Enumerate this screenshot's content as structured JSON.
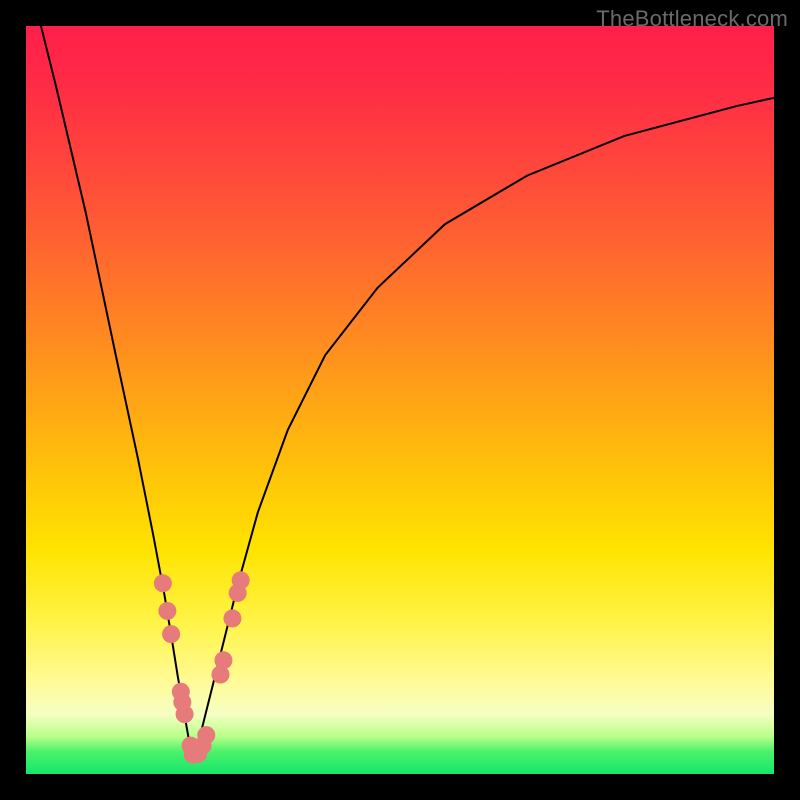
{
  "watermark": "TheBottleneck.com",
  "colors": {
    "frame": "#000000",
    "curve_stroke": "#000000",
    "marker_fill": "#e77a7a",
    "marker_stroke": "#cc5a5a"
  },
  "chart_data": {
    "type": "line",
    "title": "",
    "xlabel": "",
    "ylabel": "",
    "xlim": [
      0,
      100
    ],
    "ylim": [
      0,
      100
    ],
    "grid": false,
    "curve": {
      "description": "V-shaped bottleneck curve; two branches meeting at minimum",
      "left_branch": {
        "x": [
          0,
          4,
          8,
          12,
          15,
          17,
          18.5,
          19.5,
          20.3,
          21,
          21.7,
          22.3
        ],
        "y": [
          108,
          92,
          75,
          56,
          42,
          32,
          24,
          18,
          13,
          9,
          5,
          2.5
        ]
      },
      "right_branch": {
        "x": [
          22.3,
          23,
          24,
          25,
          26.5,
          28.5,
          31,
          35,
          40,
          47,
          56,
          67,
          80,
          95,
          100
        ],
        "y": [
          2.5,
          4,
          8,
          12,
          18,
          26,
          35,
          46,
          56,
          65,
          73.5,
          80,
          85.3,
          89.3,
          90.4
        ]
      },
      "minimum": {
        "x": 22.3,
        "y": 2.5
      }
    },
    "markers": [
      {
        "x": 18.3,
        "y": 25.5
      },
      {
        "x": 18.9,
        "y": 21.8
      },
      {
        "x": 19.4,
        "y": 18.7
      },
      {
        "x": 20.7,
        "y": 11.0
      },
      {
        "x": 20.9,
        "y": 9.6
      },
      {
        "x": 21.2,
        "y": 8.0
      },
      {
        "x": 22.0,
        "y": 3.8
      },
      {
        "x": 22.3,
        "y": 2.6
      },
      {
        "x": 23.0,
        "y": 2.7
      },
      {
        "x": 23.6,
        "y": 3.8
      },
      {
        "x": 24.1,
        "y": 5.2
      },
      {
        "x": 26.0,
        "y": 13.3
      },
      {
        "x": 26.4,
        "y": 15.2
      },
      {
        "x": 27.6,
        "y": 20.8
      },
      {
        "x": 28.3,
        "y": 24.2
      },
      {
        "x": 28.7,
        "y": 25.9
      }
    ]
  }
}
